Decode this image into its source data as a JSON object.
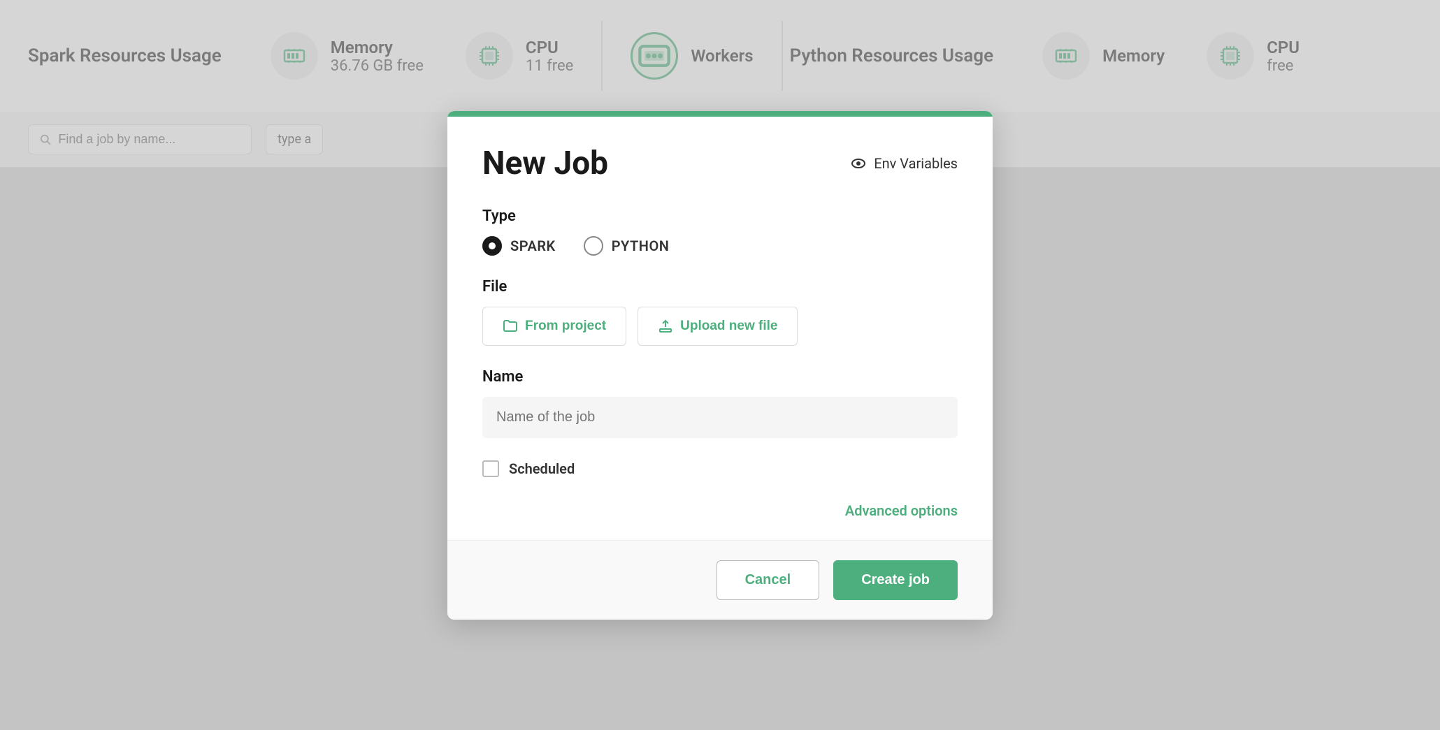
{
  "page": {
    "background_color": "#d8d8d8"
  },
  "topbar": {
    "spark_section_title": "Spark Resources Usage",
    "python_section_title": "Python Resources Usage",
    "spark_memory_label": "Memory",
    "spark_memory_value": "36.76 GB free",
    "spark_cpu_label": "CPU",
    "spark_cpu_value": "11 free",
    "workers_label": "Workers",
    "python_memory_label": "Memory",
    "python_cpu_label": "CPU",
    "python_cpu_value": "free"
  },
  "searchbar": {
    "search_placeholder": "Find a job by name...",
    "type_filter_label": "type a"
  },
  "modal": {
    "title": "New Job",
    "env_variables_label": "Env Variables",
    "type_section_label": "Type",
    "spark_radio_label": "SPARK",
    "python_radio_label": "PYTHON",
    "file_section_label": "File",
    "from_project_label": "From project",
    "upload_new_file_label": "Upload new file",
    "name_section_label": "Name",
    "name_placeholder": "Name of the job",
    "scheduled_label": "Scheduled",
    "advanced_options_label": "Advanced options",
    "cancel_label": "Cancel",
    "create_job_label": "Create job"
  }
}
